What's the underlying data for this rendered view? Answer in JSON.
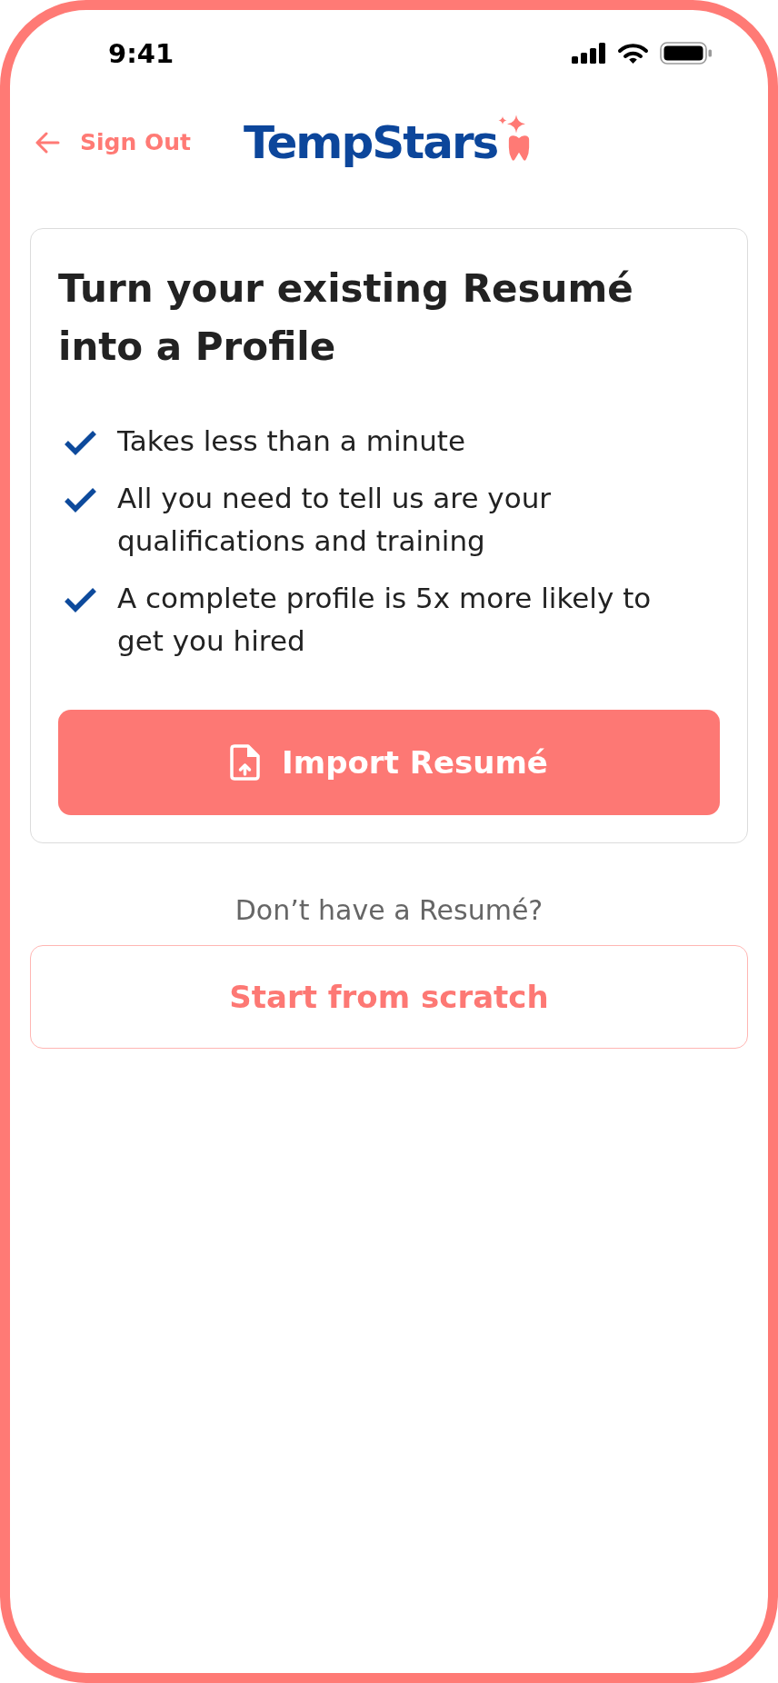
{
  "status_bar": {
    "time": "9:41"
  },
  "header": {
    "back_link": "Sign Out",
    "logo": "TempStars"
  },
  "card": {
    "title": "Turn your existing Resumé into a Profile",
    "benefits": [
      "Takes less than a minute",
      "All you need to tell us are your qualifications and training",
      "A complete profile is 5x more likely to get you hired"
    ],
    "primary_button": "Import Resumé"
  },
  "prompt": "Don’t have a Resumé?",
  "secondary_button": "Start from scratch"
}
